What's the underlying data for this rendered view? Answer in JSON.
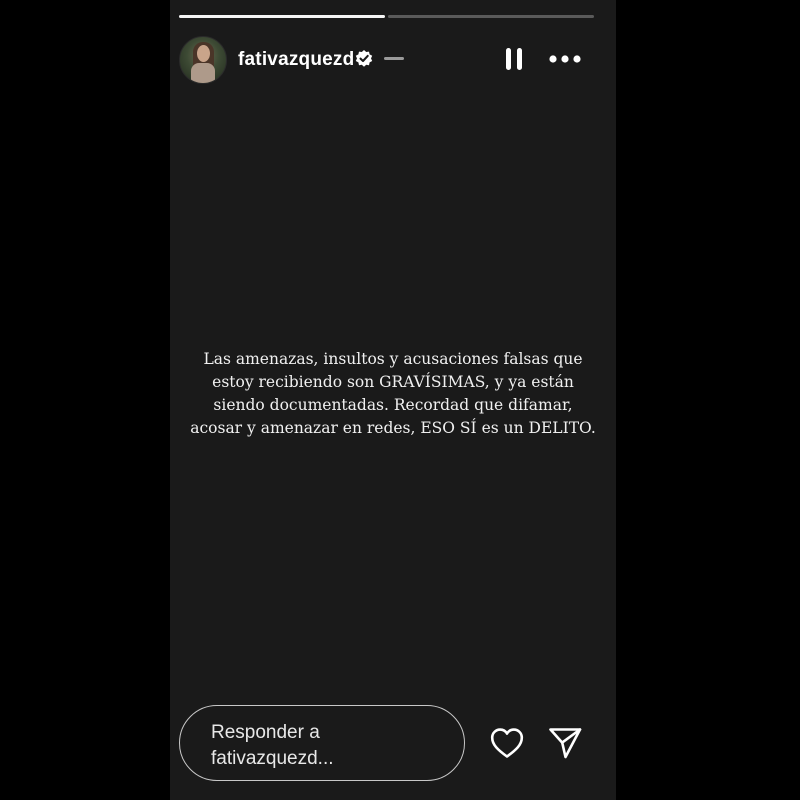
{
  "story": {
    "username": "fativazquezd",
    "progress": [
      1.0,
      0.0
    ],
    "text_lines": [
      "Las amenazas, insultos y acusaciones falsas que",
      "estoy recibiendo son GRAVÍSIMAS, y ya están",
      "siendo documentadas. Recordad que difamar,",
      "acosar y amenazar en redes, ESO SÍ es un DELITO."
    ]
  },
  "header_icons": {
    "verified": "verified-badge-icon",
    "pause": "pause-icon",
    "more": "more-options-icon"
  },
  "reply": {
    "line1": "Responder a",
    "line2": "fativazquezd..."
  },
  "footer_icons": {
    "like": "heart-icon",
    "share": "send-icon"
  },
  "colors": {
    "page_background": "#000000",
    "story_background": "#1a1a1a",
    "progress_filled": "#f5f5f5",
    "progress_empty": "#5a5a5a",
    "text": "#f0f0f0"
  }
}
